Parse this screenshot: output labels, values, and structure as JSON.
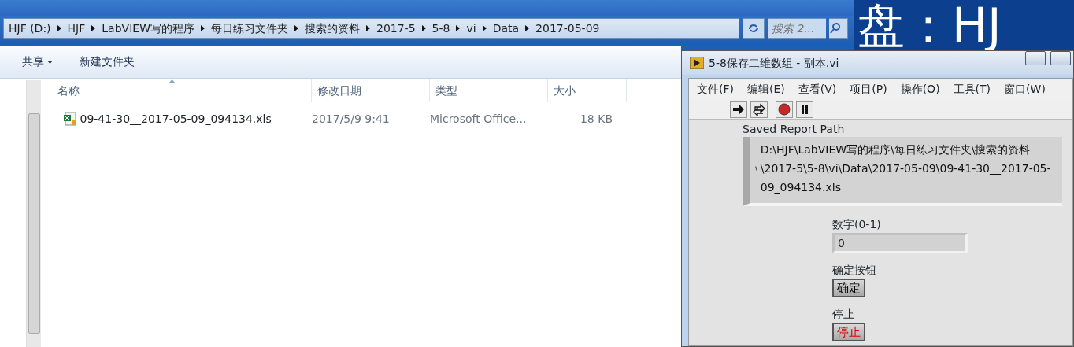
{
  "explorer": {
    "breadcrumb": [
      "HJF (D:)",
      "HJF",
      "LabVIEW写的程序",
      "每日练习文件夹",
      "搜索的资料",
      "2017-5",
      "5-8",
      "vi",
      "Data",
      "2017-05-09"
    ],
    "search": {
      "placeholder": "搜索 2..."
    },
    "toolbar": [
      {
        "label": "共享",
        "dropdown": true
      },
      {
        "label": "新建文件夹",
        "dropdown": false
      }
    ],
    "columns": [
      {
        "label": "名称",
        "sorted": true
      },
      {
        "label": "修改日期",
        "sorted": false
      },
      {
        "label": "类型",
        "sorted": false
      },
      {
        "label": "大小",
        "sorted": false
      }
    ],
    "files": [
      {
        "name": "09-41-30__2017-05-09_094134.xls",
        "modified": "2017/5/9 9:41",
        "type": "Microsoft Office...",
        "size": "18 KB"
      }
    ]
  },
  "background_text": "盘：HJ",
  "labview": {
    "title": "5-8保存二维数组 - 副本.vi",
    "menu": [
      "文件(F)",
      "编辑(E)",
      "查看(V)",
      "项目(P)",
      "操作(O)",
      "工具(T)",
      "窗口(W)"
    ],
    "controls": [
      {
        "kind": "path",
        "label": "Saved Report Path",
        "value": "D:\\HJF\\LabVIEW写的程序\\每日练习文件夹\\搜索的资料\\2017-5\\5-8\\vi\\Data\\2017-05-09\\09-41-30__2017-05-09_094134.xls"
      },
      {
        "kind": "numeric",
        "label": "数字(0-1)",
        "value": "0"
      },
      {
        "kind": "button",
        "label": "确定按钮",
        "text": "确定"
      },
      {
        "kind": "stop",
        "label": "停止",
        "text": "停止"
      }
    ]
  }
}
